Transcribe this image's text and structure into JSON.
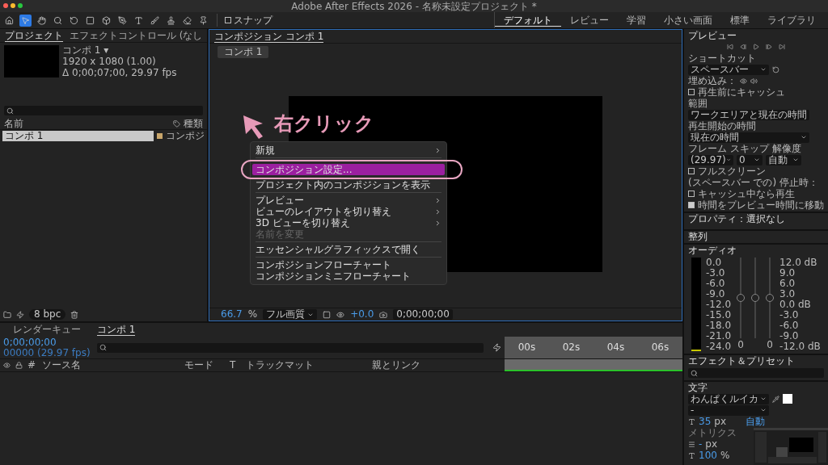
{
  "window": {
    "title": "Adobe After Effects 2026 - 名称未設定プロジェクト *"
  },
  "toolbar": {
    "snap": {
      "label": "スナップ",
      "checked": false
    },
    "workspaces": [
      {
        "label": "デフォルト",
        "selected": true
      },
      {
        "label": "レビュー",
        "selected": false
      },
      {
        "label": "学習",
        "selected": false
      },
      {
        "label": "小さい画面",
        "selected": false
      },
      {
        "label": "標準",
        "selected": false
      },
      {
        "label": "ライブラリ",
        "selected": false
      }
    ]
  },
  "project_panel": {
    "tabs": [
      {
        "label": "プロジェクト",
        "selected": true
      },
      {
        "label": "エフェクトコントロール (なし",
        "selected": false
      }
    ],
    "item": {
      "name": "コンポ 1 ▾",
      "size": "1920 x 1080 (1.00)",
      "duration": "Δ 0;00;07;00, 29.97 fps"
    },
    "columns": [
      "名前",
      "種類"
    ],
    "rows": [
      {
        "name": "コンポ 1",
        "type": "コンポジ",
        "selected": true
      }
    ],
    "bit_depth": "8 bpc"
  },
  "viewer": {
    "tab": "コンポジション コンポ 1",
    "breadcrumb": "コンポ 1",
    "annotation": "右クリック",
    "context_menu": [
      {
        "kind": "item",
        "label": "新規",
        "submenu": true,
        "disabled": false,
        "selected": false
      },
      {
        "kind": "separator"
      },
      {
        "kind": "item",
        "label": "コンポジション設定...",
        "submenu": false,
        "disabled": false,
        "selected": true
      },
      {
        "kind": "item",
        "label": "プロジェクト内のコンポジションを表示",
        "submenu": false,
        "disabled": false,
        "selected": false
      },
      {
        "kind": "separator"
      },
      {
        "kind": "item",
        "label": "プレビュー",
        "submenu": true,
        "disabled": false,
        "selected": false
      },
      {
        "kind": "item",
        "label": "ビューのレイアウトを切り替え",
        "submenu": true,
        "disabled": false,
        "selected": false
      },
      {
        "kind": "item",
        "label": "3D ビューを切り替え",
        "submenu": true,
        "disabled": false,
        "selected": false
      },
      {
        "kind": "item",
        "label": "名前を変更",
        "submenu": false,
        "disabled": true,
        "selected": false
      },
      {
        "kind": "separator"
      },
      {
        "kind": "item",
        "label": "エッセンシャルグラフィックスで開く",
        "submenu": false,
        "disabled": false,
        "selected": false
      },
      {
        "kind": "separator"
      },
      {
        "kind": "item",
        "label": "コンポジションフローチャート",
        "submenu": false,
        "disabled": false,
        "selected": false
      },
      {
        "kind": "item",
        "label": "コンポジションミニフローチャート",
        "submenu": false,
        "disabled": false,
        "selected": false
      }
    ],
    "zoom": "66.7",
    "zoom_unit": "%",
    "quality": "フル画質",
    "exposure": "+0.0",
    "timecode": "0;00;00;00"
  },
  "timeline": {
    "tabs": [
      {
        "label": "レンダーキュー",
        "selected": false
      },
      {
        "label": "コンポ 1",
        "selected": true
      }
    ],
    "timecode": "0;00;00;00",
    "frame_info": "00000 (29.97 fps)",
    "columns": [
      "#",
      "ソース名",
      "モード",
      "T",
      "トラックマット",
      "親とリンク"
    ],
    "ruler": [
      "00s",
      "02s",
      "04s",
      "06s"
    ]
  },
  "preview_panel": {
    "title": "プレビュー",
    "shortcut_label": "ショートカット",
    "shortcut": "スペースバー",
    "embed_label": "埋め込み：",
    "cache_before": {
      "label": "再生前にキャッシュ",
      "checked": false
    },
    "range_label": "範囲",
    "range": "ワークエリアと現在の時間",
    "start_label": "再生開始の時間",
    "start": "現在の時間",
    "frame_label": "フレーム",
    "skip_label": "スキップ",
    "resolution_label": "解像度",
    "frame": "(29.97)",
    "skip": "0",
    "resolution": "自動",
    "fullscreen": {
      "label": "フルスクリーン",
      "checked": false
    },
    "stop_label": "(スペースバー での) 停止時：",
    "stop_options": [
      {
        "label": "キャッシュ中なら再生",
        "checked": false
      },
      {
        "label": "時間をプレビュー時間に移動",
        "checked": true
      }
    ]
  },
  "properties_panel": {
    "title": "プロパティ：選択なし"
  },
  "align_panel": {
    "title": "整列"
  },
  "audio_panel": {
    "title": "オーディオ",
    "left_scale": [
      "0.0",
      "-3.0",
      "-6.0",
      "-9.0",
      "-12.0",
      "-15.0",
      "-18.0",
      "-21.0",
      "-24.0"
    ],
    "right_scale": [
      "12.0 dB",
      "9.0",
      "6.0",
      "3.0",
      "0.0 dB",
      "-3.0",
      "-6.0",
      "-9.0",
      "-12.0 dB"
    ],
    "sliders": [
      {
        "level": 0.5,
        "reading": "0"
      },
      {
        "level": 0.5
      },
      {
        "level": 0.5,
        "reading": "0"
      }
    ]
  },
  "effects_panel": {
    "title": "エフェクト＆プリセット"
  },
  "character_panel": {
    "title": "文字",
    "font": "わんぱくルイカ",
    "style": "-",
    "size": "35",
    "size_unit": "px",
    "leading": "自動",
    "kerning": "メトリクス",
    "tracking": "-",
    "tracking_unit": "px",
    "scale": "100",
    "scale_unit": "%"
  }
}
